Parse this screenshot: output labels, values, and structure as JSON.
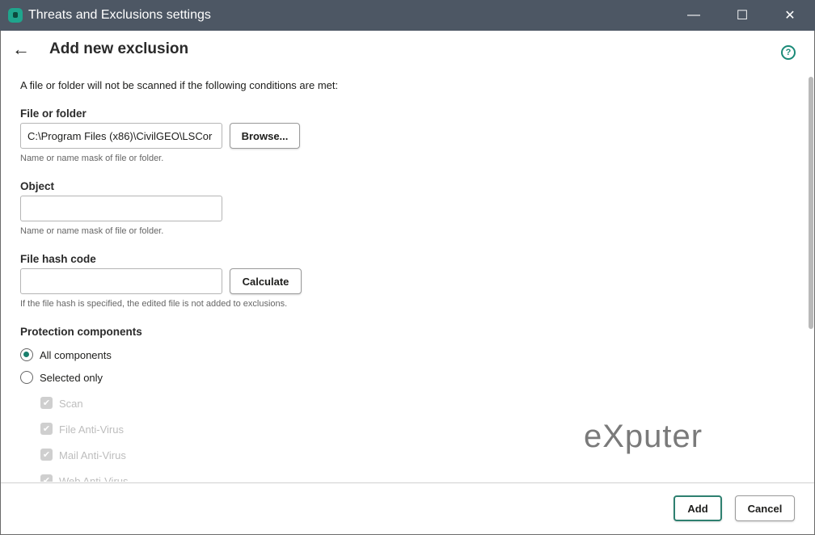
{
  "window": {
    "title": "Threats and Exclusions settings",
    "minimize": "—",
    "maximize": "☐",
    "close": "✕"
  },
  "header": {
    "back": "←",
    "title": "Add new exclusion",
    "help": "?"
  },
  "intro": "A file or folder will not be scanned if the following conditions are met:",
  "file_or_folder": {
    "label": "File or folder",
    "value": "C:\\Program Files (x86)\\CivilGEO\\LSCor",
    "browse": "Browse...",
    "hint": "Name or name mask of file or folder."
  },
  "object": {
    "label": "Object",
    "value": "",
    "hint": "Name or name mask of file or folder."
  },
  "hash": {
    "label": "File hash code",
    "value": "",
    "calculate": "Calculate",
    "hint": "If the file hash is specified, the edited file is not added to exclusions."
  },
  "protection": {
    "label": "Protection components",
    "all": "All components",
    "selected": "Selected only",
    "selected_option": "All components",
    "components": [
      {
        "label": "Scan",
        "checked": true
      },
      {
        "label": "File Anti-Virus",
        "checked": true
      },
      {
        "label": "Mail Anti-Virus",
        "checked": true
      },
      {
        "label": "Web Anti-Virus",
        "checked": true
      }
    ]
  },
  "footer": {
    "add": "Add",
    "cancel": "Cancel"
  },
  "watermark": "eXputer",
  "colors": {
    "accent": "#1a7f6d",
    "titlebar": "#4d5764"
  }
}
